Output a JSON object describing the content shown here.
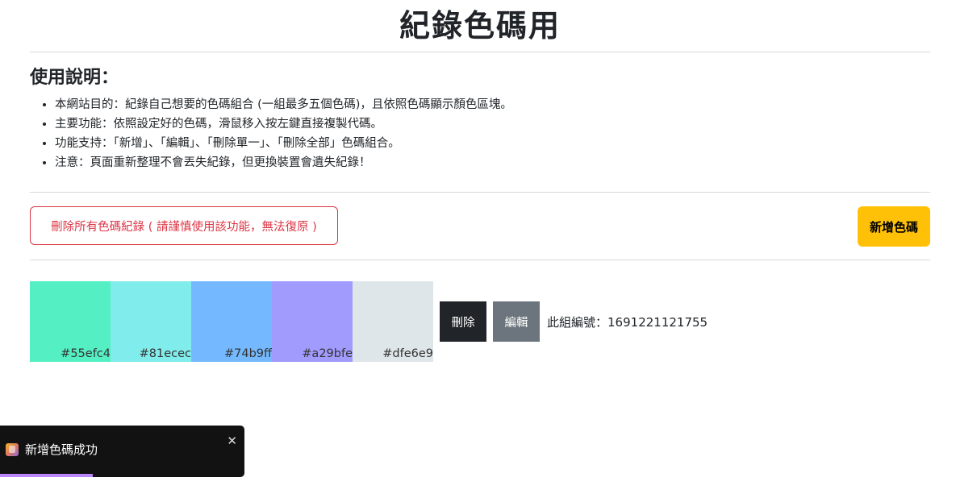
{
  "page": {
    "title": "紀錄色碼用"
  },
  "usage": {
    "heading": "使用說明：",
    "items": [
      "本網站目的：紀錄自己想要的色碼組合 (一組最多五個色碼)，且依照色碼顯示顏色區塊。",
      "主要功能：依照設定好的色碼，滑鼠移入按左鍵直接複製代碼。",
      "功能支持：「新增」、「編輯」、「刪除單一」、「刪除全部」色碼組合。",
      "注意：頁面重新整理不會丟失紀錄，但更換裝置會遺失紀錄！"
    ]
  },
  "actions": {
    "delete_all_label": "刪除所有色碼紀錄 ( 請謹慎使用該功能，無法復原 )",
    "add_label": "新增色碼"
  },
  "palette": {
    "colors": [
      "#55efc4",
      "#81ecec",
      "#74b9ff",
      "#a29bfe",
      "#dfe6e9"
    ],
    "delete_label": "刪除",
    "edit_label": "編輯",
    "id_label": "此組編號：",
    "id_value": "1691221121755"
  },
  "toast": {
    "message": "新增色碼成功",
    "close_symbol": "✕",
    "progress": 0.38
  }
}
